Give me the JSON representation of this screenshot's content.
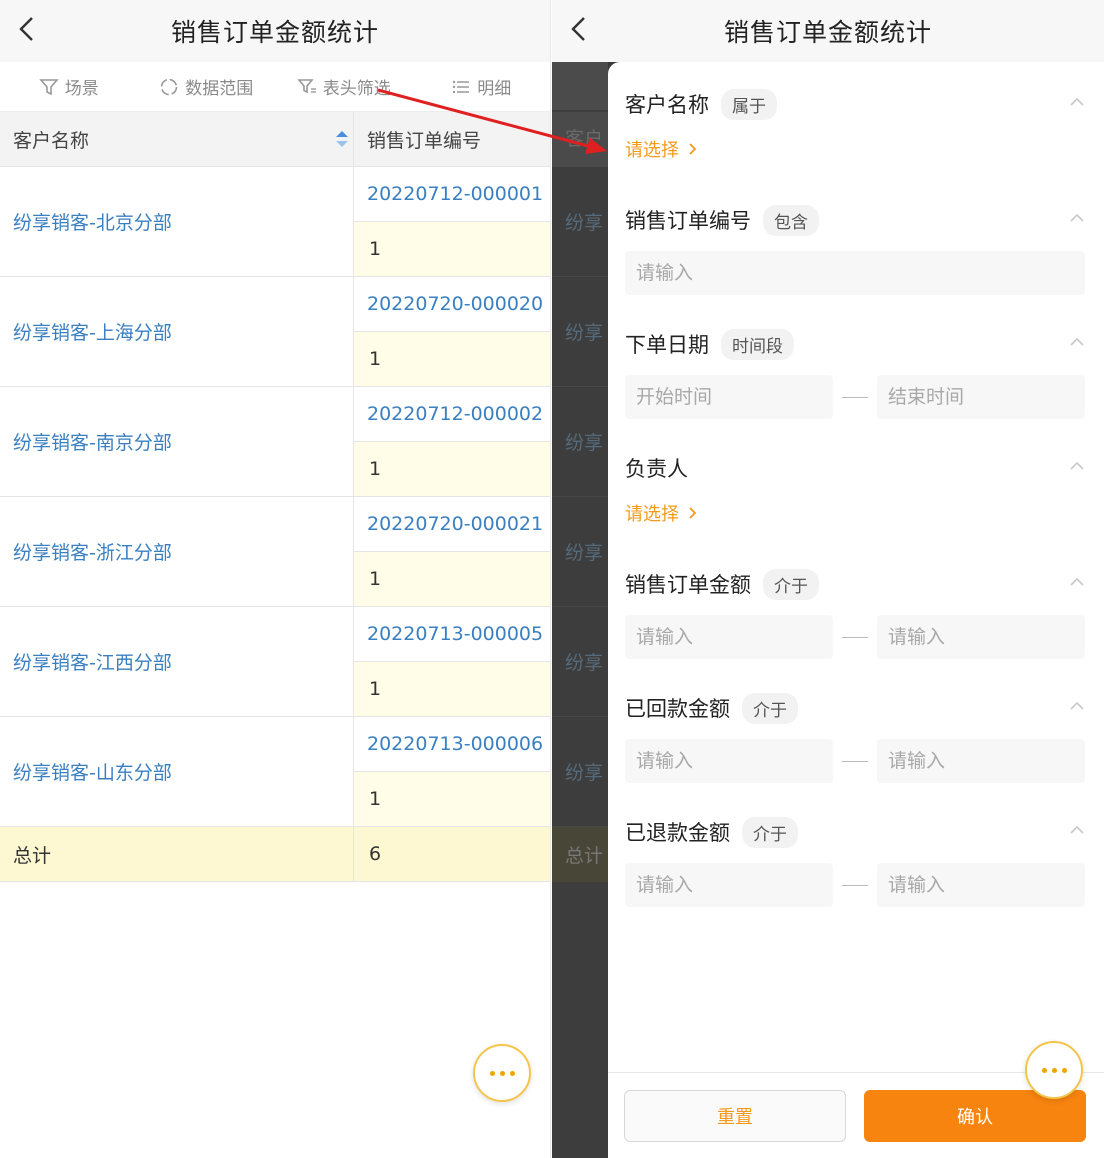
{
  "left": {
    "title": "销售订单金额统计",
    "toolbar": [
      {
        "icon": "funnel-icon",
        "label": "场景"
      },
      {
        "icon": "range-icon",
        "label": "数据范围"
      },
      {
        "icon": "header-filter-icon",
        "label": "表头筛选"
      },
      {
        "icon": "list-icon",
        "label": "明细"
      }
    ],
    "table": {
      "columns": [
        "客户名称",
        "销售订单编号"
      ],
      "rows": [
        {
          "customer": "纷享销客-北京分部",
          "order": "20220712-000001",
          "count": "1"
        },
        {
          "customer": "纷享销客-上海分部",
          "order": "20220720-000020",
          "count": "1"
        },
        {
          "customer": "纷享销客-南京分部",
          "order": "20220712-000002",
          "count": "1"
        },
        {
          "customer": "纷享销客-浙江分部",
          "order": "20220720-000021",
          "count": "1"
        },
        {
          "customer": "纷享销客-江西分部",
          "order": "20220713-000005",
          "count": "1"
        },
        {
          "customer": "纷享销客-山东分部",
          "order": "20220713-000006",
          "count": "1"
        }
      ],
      "total_label": "总计",
      "total_value": "6"
    }
  },
  "right": {
    "title": "销售订单金额统计",
    "background_fragments": {
      "header": "客户",
      "row": "纷享",
      "total": "总计"
    },
    "filters": {
      "customer": {
        "label": "客户名称",
        "operator": "属于",
        "action": "请选择"
      },
      "order_no": {
        "label": "销售订单编号",
        "operator": "包含",
        "placeholder": "请输入"
      },
      "order_date": {
        "label": "下单日期",
        "operator": "时间段",
        "start_placeholder": "开始时间",
        "end_placeholder": "结束时间"
      },
      "owner": {
        "label": "负责人",
        "action": "请选择"
      },
      "order_amount": {
        "label": "销售订单金额",
        "operator": "介于",
        "min_placeholder": "请输入",
        "max_placeholder": "请输入"
      },
      "received_amount": {
        "label": "已回款金额",
        "operator": "介于",
        "min_placeholder": "请输入",
        "max_placeholder": "请输入"
      },
      "refund_amount": {
        "label": "已退款金额",
        "operator": "介于",
        "min_placeholder": "请输入",
        "max_placeholder": "请输入"
      }
    },
    "footer": {
      "reset": "重置",
      "confirm": "确认"
    }
  },
  "colors": {
    "accent": "#f7840f",
    "link": "#3a7fc0",
    "select_link": "#f39a1c",
    "arrow": "#e02020"
  }
}
